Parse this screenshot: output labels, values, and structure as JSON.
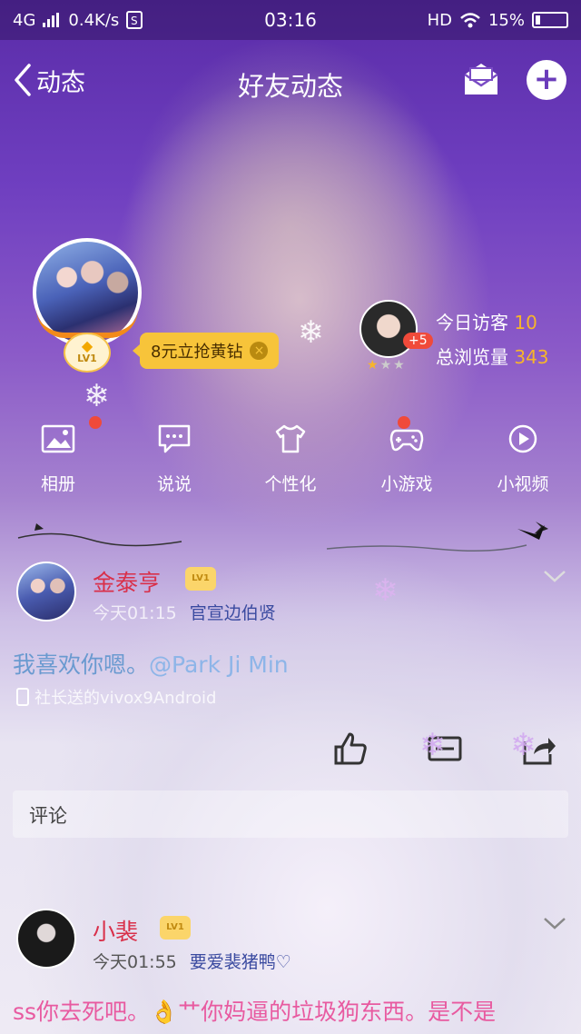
{
  "status_bar": {
    "network": "4G",
    "speed": "0.4K/s",
    "time": "03:16",
    "hd": "HD",
    "battery": "15%"
  },
  "nav": {
    "back_label": "动态",
    "title": "好友动态"
  },
  "profile": {
    "level": "LV1",
    "promo": "8元立抢黄钻",
    "visitor_extra": "+5",
    "today_visitors_label": "今日访客",
    "today_visitors": "10",
    "total_views_label": "总浏览量",
    "total_views": "343"
  },
  "quick_menu": [
    {
      "label": "相册",
      "icon": "album-icon"
    },
    {
      "label": "说说",
      "icon": "chat-icon"
    },
    {
      "label": "个性化",
      "icon": "tshirt-icon"
    },
    {
      "label": "小游戏",
      "icon": "gamepad-icon"
    },
    {
      "label": "小视频",
      "icon": "play-icon"
    }
  ],
  "post": {
    "author": "金泰亨",
    "level": "LV1",
    "time": "今天01:15",
    "tag": "官宣边伯贤",
    "text": "我喜欢你嗯。",
    "mention": "@Park Ji Min",
    "device": "社长送的vivox9Android"
  },
  "comment_box": {
    "placeholder": "评论"
  },
  "comment": {
    "author": "小裴",
    "level": "LV1",
    "time": "今天01:55",
    "tag": "要爱裴猪鸭♡",
    "text": "ss你去死吧。👌艹你妈逼的垃圾狗东西。是不是"
  }
}
